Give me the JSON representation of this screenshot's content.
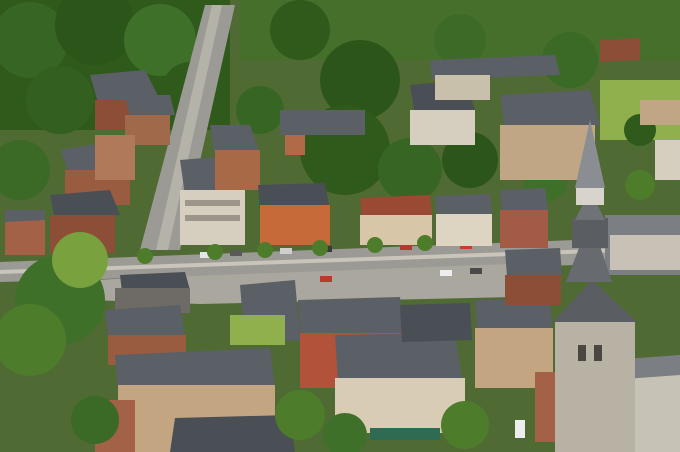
{
  "scene": {
    "subject": "aerial-town-view",
    "palette": {
      "foliage_dark": "#2f5a1c",
      "foliage_mid": "#4d7c2a",
      "foliage_light": "#79a23e",
      "roof_slate": "#5b5f66",
      "roof_dark": "#3d4148",
      "roof_red": "#9a4a32",
      "brick": "#8c4e36",
      "stone": "#b8a88a",
      "facade_light": "#d6cfc0",
      "road": "#9c9a94",
      "road_light": "#c9c5bb",
      "lawn": "#8fb04c"
    }
  }
}
